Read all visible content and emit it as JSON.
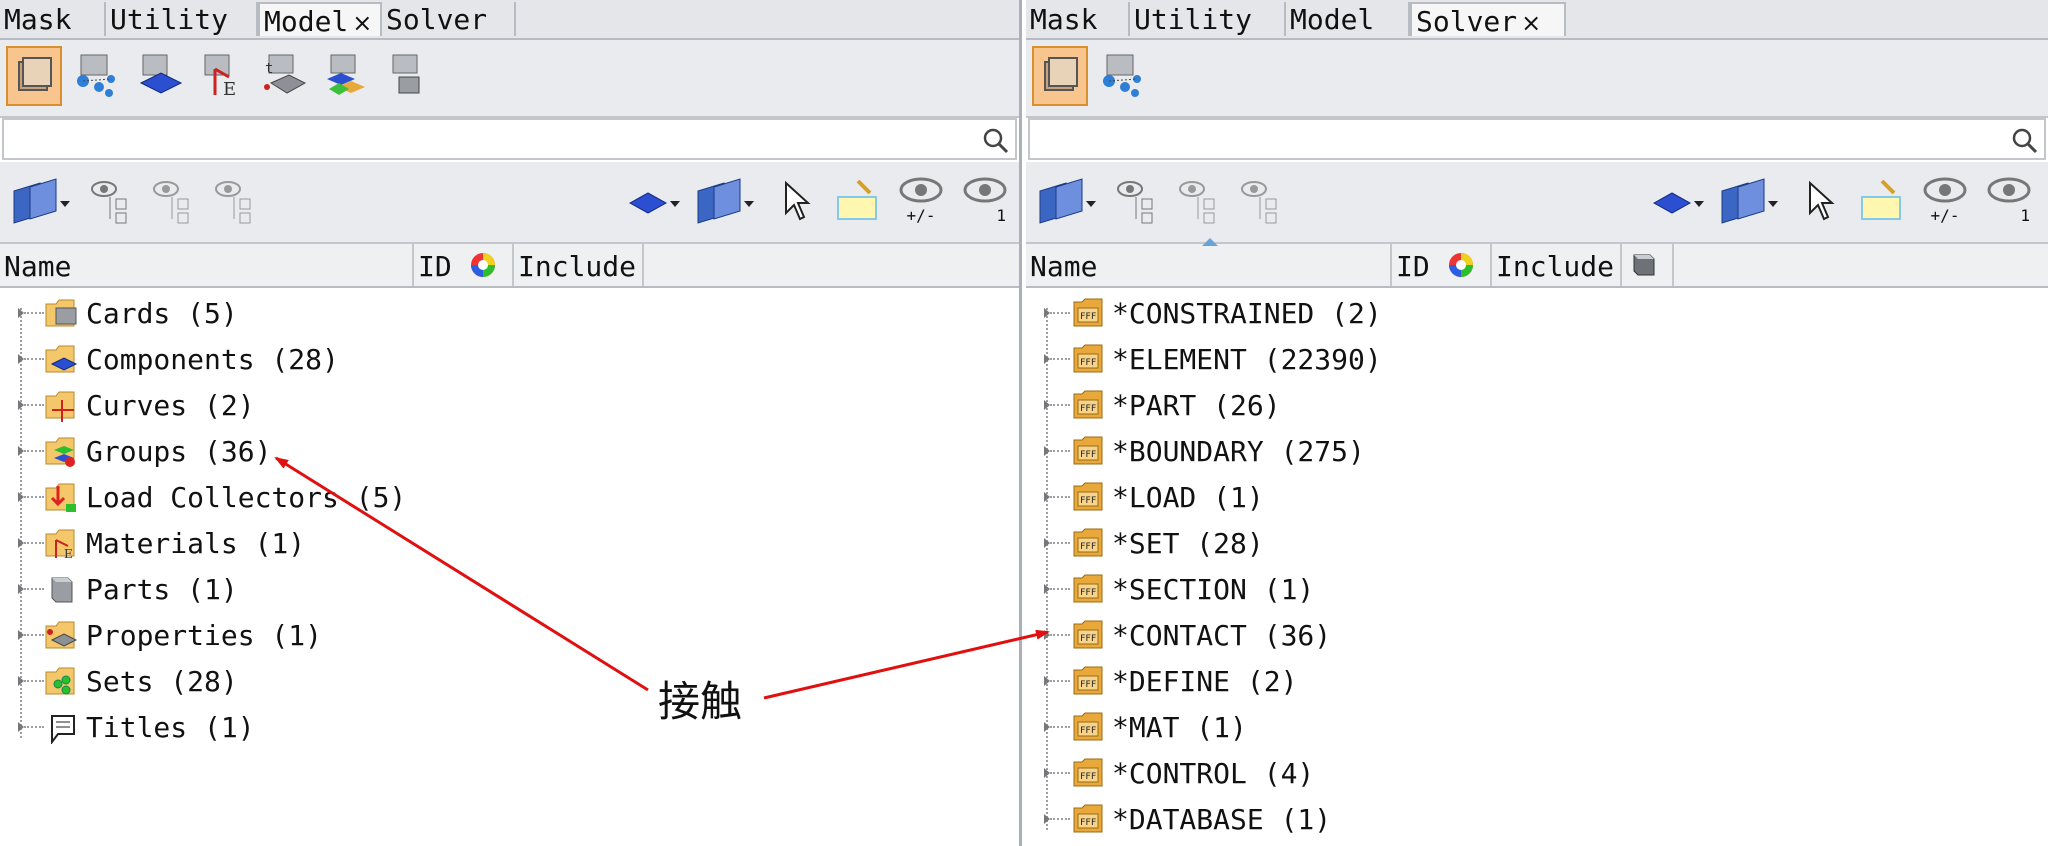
{
  "left_panel": {
    "tabs": [
      {
        "label": "Mask",
        "active": false
      },
      {
        "label": "Utility",
        "active": false
      },
      {
        "label": "Model",
        "active": true,
        "close": "×"
      },
      {
        "label": "Solver",
        "active": false
      }
    ],
    "search": {
      "value": "",
      "placeholder": ""
    },
    "columns": {
      "name": "Name",
      "id": "ID",
      "include": "Include"
    },
    "items": [
      {
        "label": "Cards (5)",
        "icon": "cards-folder-icon"
      },
      {
        "label": "Components (28)",
        "icon": "components-folder-icon"
      },
      {
        "label": "Curves (2)",
        "icon": "curves-folder-icon"
      },
      {
        "label": "Groups (36)",
        "icon": "groups-folder-icon"
      },
      {
        "label": "Load Collectors (5)",
        "icon": "load-collectors-folder-icon"
      },
      {
        "label": "Materials (1)",
        "icon": "materials-folder-icon"
      },
      {
        "label": "Parts (1)",
        "icon": "parts-icon"
      },
      {
        "label": "Properties (1)",
        "icon": "properties-folder-icon"
      },
      {
        "label": "Sets (28)",
        "icon": "sets-folder-icon"
      },
      {
        "label": "Titles (1)",
        "icon": "titles-icon"
      }
    ]
  },
  "right_panel": {
    "tabs": [
      {
        "label": "Mask",
        "active": false
      },
      {
        "label": "Utility",
        "active": false
      },
      {
        "label": "Model",
        "active": false
      },
      {
        "label": "Solver",
        "active": true,
        "close": "×"
      }
    ],
    "search": {
      "value": "",
      "placeholder": ""
    },
    "columns": {
      "name": "Name",
      "id": "ID",
      "include": "Include"
    },
    "items": [
      {
        "label": "*CONSTRAINED (2)"
      },
      {
        "label": "*ELEMENT (22390)"
      },
      {
        "label": "*PART (26)"
      },
      {
        "label": "*BOUNDARY (275)"
      },
      {
        "label": "*LOAD (1)"
      },
      {
        "label": "*SET (28)"
      },
      {
        "label": "*SECTION (1)"
      },
      {
        "label": "*CONTACT (36)"
      },
      {
        "label": "*DEFINE (2)"
      },
      {
        "label": "*MAT (1)"
      },
      {
        "label": "*CONTROL (4)"
      },
      {
        "label": "*DATABASE (1)"
      }
    ]
  },
  "toolbar2_labels": {
    "plus_minus": "+/-",
    "one": "1"
  },
  "annotation": {
    "text": "接触",
    "color": "#e01010"
  },
  "colors": {
    "selected_tab_bg": "#f9c58f",
    "arrow": "#e01010",
    "keyword_icon": "#e8a83a"
  }
}
